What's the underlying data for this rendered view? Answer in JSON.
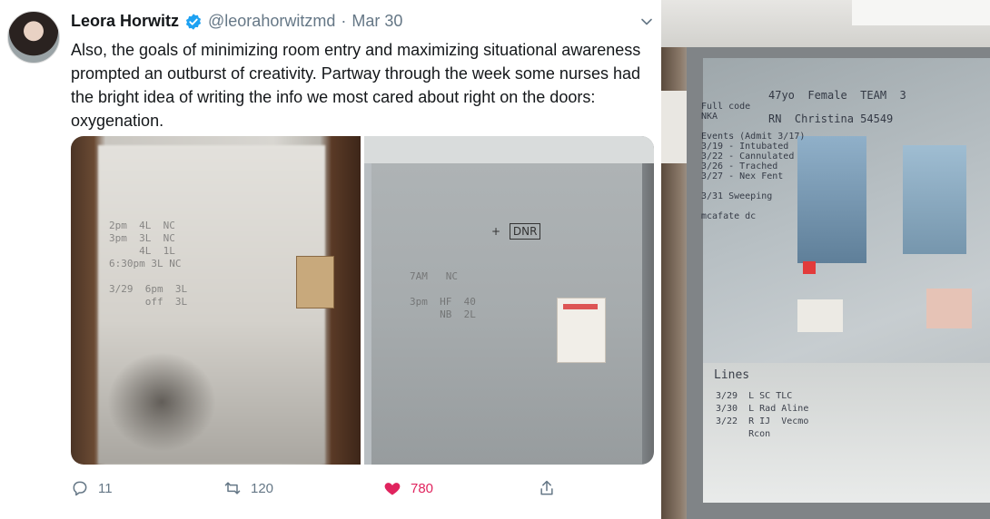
{
  "tweet": {
    "author_name": "Leora Horwitz",
    "handle": "@leorahorwitzmd",
    "separator": "·",
    "date": "Mar 30",
    "text": "Also, the goals of minimizing room entry and maximizing situational awareness prompted an outburst of creativity. Partway through the week some nurses had the bright idea of writing the info we most cared about right on the doors: oxygenation.",
    "actions": {
      "replies": "11",
      "retweets": "120",
      "likes": "780"
    },
    "icons": {
      "verified": "verified-badge-icon",
      "more": "chevron-down-icon",
      "reply": "reply-icon",
      "retweet": "retweet-icon",
      "like": "heart-icon",
      "share": "share-icon"
    },
    "colors": {
      "verified": "#1da1f2",
      "like": "#e0245e",
      "muted": "#657786"
    }
  },
  "media": {
    "photo_left_writing": "2pm  4L  NC\n3pm  3L  NC\n     4L  1L\n6:30pm 3L NC\n\n3/29  6pm  3L\n      off  3L",
    "photo_mid_code": "+",
    "photo_mid_dnr": "DNR",
    "photo_mid_writing": "7AM   NC  \n\n3pm  HF  40\n     NB  2L"
  },
  "door_photo": {
    "top_line": "47yo  Female  TEAM  3\nRN  Christina 54549",
    "left_notes": "Full code\nNKA\n\nEvents (Admit 3/17)\n3/19 - Intubated\n3/22 - Cannulated\n3/26 - Trached\n3/27 - Nex Fent\n\n3/31 Sweeping\n\nmcafate dc",
    "lines_title": "Lines",
    "lines": "3/29  L SC TLC\n3/30  L Rad Aline\n3/22  R IJ  Vecmo\n      Rcon"
  }
}
